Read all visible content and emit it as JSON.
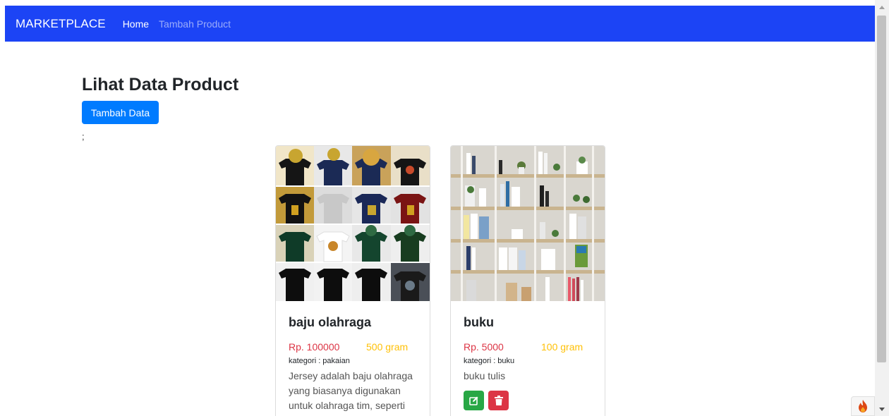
{
  "navbar": {
    "brand": "MARKETPLACE",
    "links": [
      {
        "label": "Home",
        "active": true
      },
      {
        "label": "Tambah Product",
        "active": false
      }
    ],
    "color": "#1c44f5"
  },
  "main": {
    "title": "Lihat Data Product",
    "add_button_label": "Tambah Data",
    "stray_text": ";"
  },
  "products": [
    {
      "name": "baju olahraga",
      "price": "Rp. 100000",
      "weight": "500 gram",
      "category": "kategori : pakaian",
      "description": "Jersey adalah baju olahraga yang biasanya digunakan untuk olahraga tim, seperti",
      "image": "tshirt-grid-photo"
    },
    {
      "name": "buku",
      "price": "Rp. 5000",
      "weight": "100 gram",
      "category": "kategori : buku",
      "description": "buku tulis",
      "image": "bookshelf-photo"
    }
  ],
  "icons": {
    "edit": "edit-icon",
    "delete": "trash-icon",
    "debug": "flame-icon"
  },
  "colors": {
    "primary_button": "#007bff",
    "price": "#dc3545",
    "weight": "#ffc107",
    "edit_button": "#28a745",
    "delete_button": "#dc3545"
  }
}
